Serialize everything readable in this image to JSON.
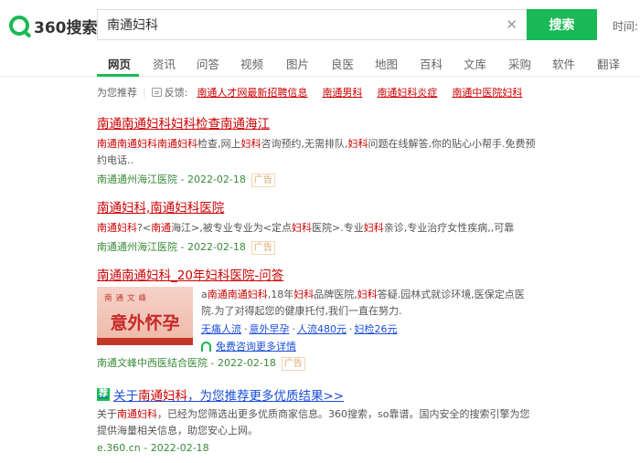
{
  "header": {
    "logo_text": "360搜索",
    "search_value": "南通妇科",
    "search_button": "搜索",
    "time_filter": "时间: 不限"
  },
  "nav": {
    "items": [
      "网页",
      "资讯",
      "问答",
      "视频",
      "图片",
      "良医",
      "地图",
      "百科",
      "文库",
      "采购",
      "软件",
      "翻译"
    ],
    "active": "网页"
  },
  "recommend": {
    "label": "为您推荐",
    "feedback": "反馈:",
    "links": [
      "南通人才网最新招聘信息",
      "南通男科",
      "南通妇科炎症",
      "南通中医院妇科"
    ]
  },
  "results": [
    {
      "title": "南通南通妇科妇科检查南通海江",
      "desc_parts": [
        "南通南通妇科南通妇科",
        "检查,网上",
        "妇科",
        "咨询预约,无需排队,",
        "妇科",
        "问题在线解答,你的贴心小帮手.免费预约电话.."
      ],
      "source": "南通通州海江医院 - 2022-02-18",
      "ad_tag": "广告"
    },
    {
      "title": "南通妇科,南通妇科医院",
      "desc_parts": [
        "南通妇科",
        "?<",
        "南通",
        "海江>,被专业专业为<定点",
        "妇科",
        "医院>.专业",
        "妇科",
        "亲诊,专业治疗女性疾病,,可靠"
      ],
      "source": "南通通州海江医院 - 2022-02-18",
      "ad_tag": "广告"
    },
    {
      "title": "南通南通妇科_20年妇科医院-问答",
      "image_top": "南通文峰",
      "image_main": "意外怀孕",
      "desc_parts": [
        "a",
        "南通南通妇科",
        ",18年",
        "妇科",
        "品牌医院,",
        "妇科",
        "答疑.园林式就诊环境,医保定点医院.为了对得起您的健康托付,我们一直在努力."
      ],
      "links": [
        "无痛人流",
        "意外早孕",
        "人流480元",
        "妇检26元"
      ],
      "consult": "免费咨询更多详情",
      "source": "南通文峰中西医结合医院 - 2022-02-18",
      "ad_tag": "广告"
    },
    {
      "badge": "荐",
      "title_prefix": "关于",
      "title_hl": "南通妇科",
      "title_suffix": "，为您推荐更多优质结果>>",
      "desc_parts": [
        "关于",
        "南通妇科",
        "，已经为您筛选出更多优质商家信息。360搜索，so靠谱。国内安全的搜索引擎为您提供海量相关信息，助您安心上网。"
      ],
      "source": "e.360.cn - 2022-02-18"
    }
  ]
}
